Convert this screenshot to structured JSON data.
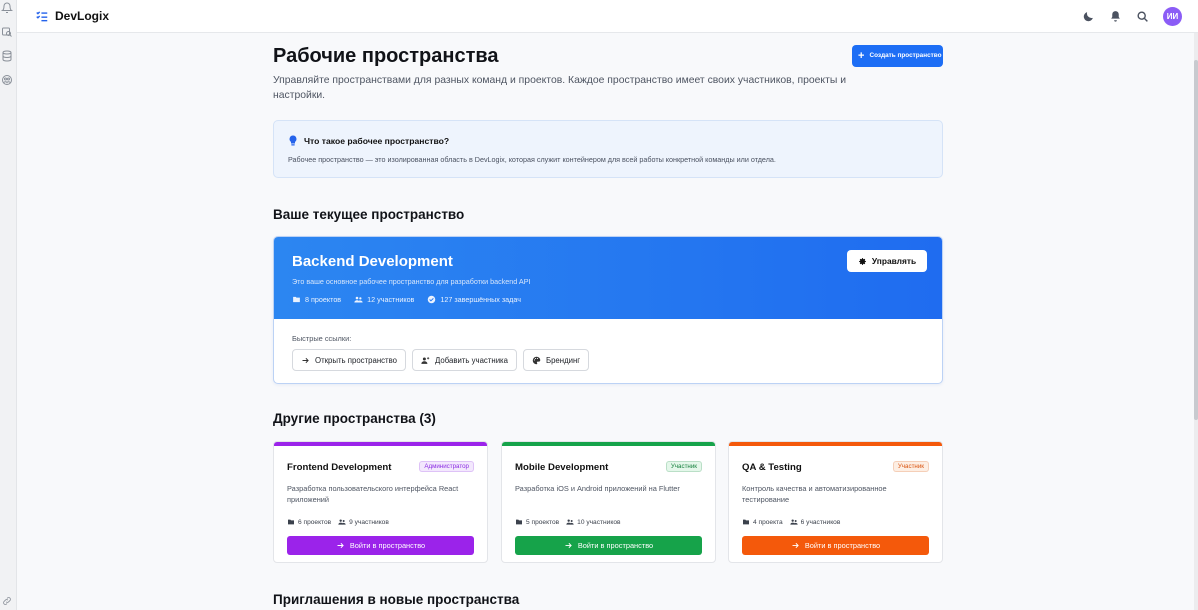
{
  "app": {
    "name": "DevLogix",
    "avatar_initials": "ИИ"
  },
  "header": {
    "title": "Рабочие пространства",
    "description": "Управляйте пространствами для разных команд и проектов. Каждое пространство имеет своих участников, проекты и настройки.",
    "create_label": "Создать пространство",
    "create_icon": "plus-icon"
  },
  "info": {
    "title": "Что такое рабочее пространство?",
    "text": "Рабочее пространство — это изолированная область в DevLogix, которая служит контейнером для всей работы конкретной команды или отдела.",
    "icon": "lightbulb-icon"
  },
  "current": {
    "section_title": "Ваше текущее пространство",
    "name": "Backend Development",
    "description": "Это ваше основное рабочее пространство для разработки backend API",
    "stats": {
      "projects": "8 проектов",
      "members": "12 участников",
      "tasks": "127 завершённых задач"
    },
    "manage_label": "Управлять",
    "quick_links_label": "Быстрые ссылки:",
    "quick_links": {
      "open": "Открыть пространство",
      "add_member": "Добавить участника",
      "branding": "Брендинг"
    }
  },
  "others": {
    "section_title": "Другие пространства (3)",
    "enter_label": "Войти в пространство",
    "items": [
      {
        "name": "Frontend Development",
        "role": "Администратор",
        "description": "Разработка пользовательского интерфейса React приложений",
        "projects": "6 проектов",
        "members": "9 участников",
        "color": "#9b23ea",
        "badge_bg": "#f3e8fd",
        "badge_fg": "#8a2be2"
      },
      {
        "name": "Mobile Development",
        "role": "Участник",
        "description": "Разработка iOS и Android приложений на Flutter",
        "projects": "5 проектов",
        "members": "10 участников",
        "color": "#16a34a",
        "badge_bg": "#e4f7ea",
        "badge_fg": "#15803d"
      },
      {
        "name": "QA & Testing",
        "role": "Участник",
        "description": "Контроль качества и автоматизированное тестирование",
        "projects": "4 проекта",
        "members": "6 участников",
        "color": "#f4590b",
        "badge_bg": "#fdeee3",
        "badge_fg": "#d9530f"
      }
    ]
  },
  "invites": {
    "section_title": "Приглашения в новые пространства"
  }
}
